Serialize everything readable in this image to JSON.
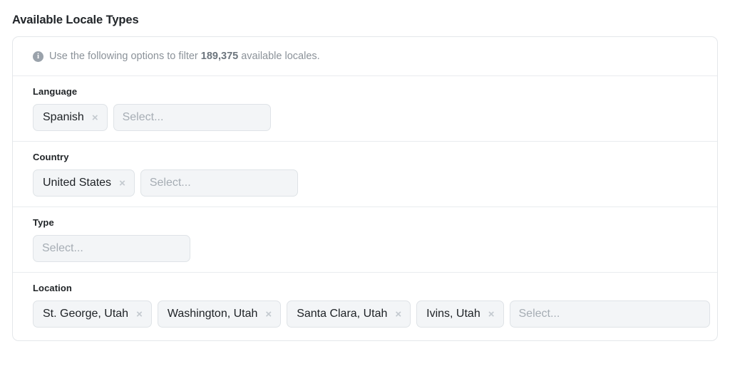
{
  "page": {
    "title": "Available Locale Types"
  },
  "info": {
    "icon": "info-circle-icon",
    "prefix": "Use the following options to filter ",
    "count": "189,375",
    "suffix": " available locales."
  },
  "filters": [
    {
      "key": "language",
      "label": "Language",
      "chips": [
        {
          "label": "Spanish",
          "remove": "×"
        }
      ],
      "placeholder": "Select...",
      "select_class": "select-lang"
    },
    {
      "key": "country",
      "label": "Country",
      "chips": [
        {
          "label": "United States",
          "remove": "×"
        }
      ],
      "placeholder": "Select...",
      "select_class": "select-country"
    },
    {
      "key": "type",
      "label": "Type",
      "chips": [],
      "placeholder": "Select...",
      "select_class": "select-type"
    },
    {
      "key": "location",
      "label": "Location",
      "chips": [
        {
          "label": "St. George, Utah",
          "remove": "×"
        },
        {
          "label": "Washington, Utah",
          "remove": "×"
        },
        {
          "label": "Santa Clara, Utah",
          "remove": "×"
        },
        {
          "label": "Ivins, Utah",
          "remove": "×"
        }
      ],
      "placeholder": "Select...",
      "select_class": "select-loc"
    }
  ],
  "colors": {
    "card_border": "#e4e7ea",
    "divider": "#e9ecef",
    "chip_bg": "#f3f5f7",
    "chip_border": "#dfe3e7",
    "placeholder_text": "#a6adb4",
    "info_text": "#8b9299",
    "heading_text": "#212529"
  }
}
